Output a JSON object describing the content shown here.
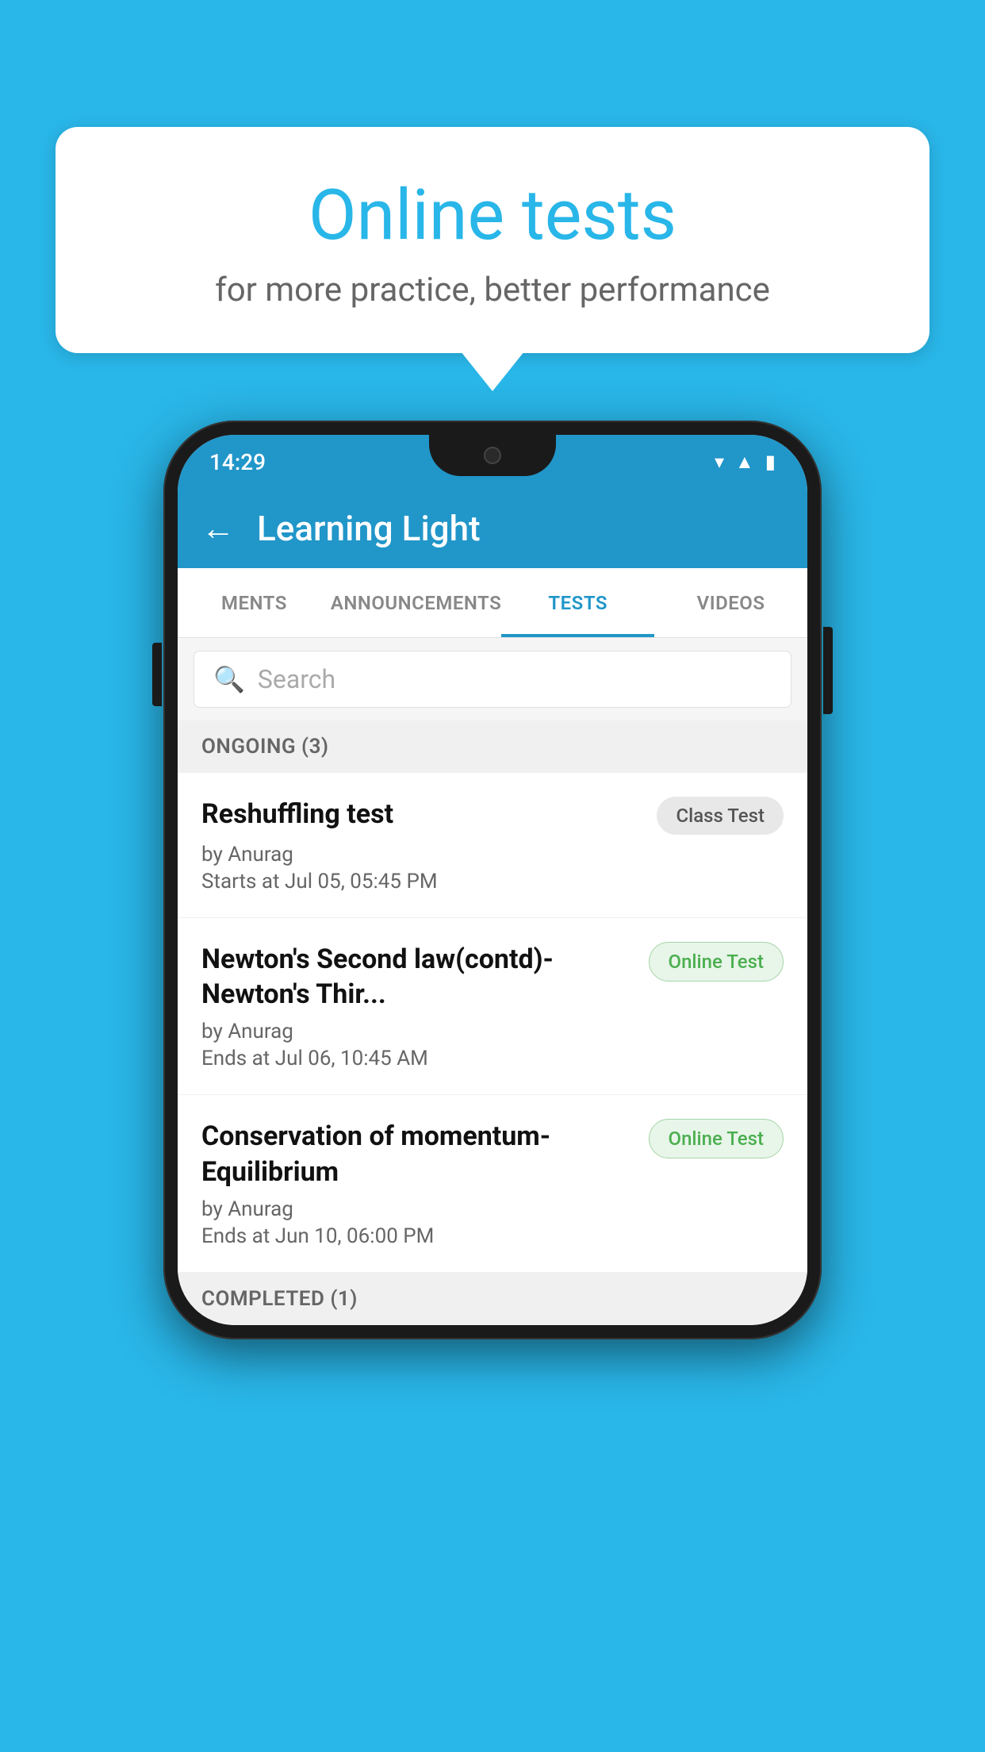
{
  "background": {
    "color": "#29b6e8"
  },
  "speech_bubble": {
    "title": "Online tests",
    "subtitle": "for more practice, better performance"
  },
  "phone": {
    "status_bar": {
      "time": "14:29",
      "icons": [
        "wifi",
        "signal",
        "battery"
      ]
    },
    "app_bar": {
      "title": "Learning Light",
      "back_label": "←"
    },
    "tabs": [
      {
        "label": "MENTS",
        "active": false
      },
      {
        "label": "ANNOUNCEMENTS",
        "active": false
      },
      {
        "label": "TESTS",
        "active": true
      },
      {
        "label": "VIDEOS",
        "active": false
      }
    ],
    "search": {
      "placeholder": "Search"
    },
    "ongoing_section": {
      "label": "ONGOING (3)"
    },
    "test_items": [
      {
        "name": "Reshuffling test",
        "badge": "Class Test",
        "badge_type": "class",
        "by": "by Anurag",
        "time_label": "Starts at",
        "time": "Jul 05, 05:45 PM"
      },
      {
        "name": "Newton's Second law(contd)-Newton's Thir...",
        "badge": "Online Test",
        "badge_type": "online",
        "by": "by Anurag",
        "time_label": "Ends at",
        "time": "Jul 06, 10:45 AM"
      },
      {
        "name": "Conservation of momentum-Equilibrium",
        "badge": "Online Test",
        "badge_type": "online",
        "by": "by Anurag",
        "time_label": "Ends at",
        "time": "Jun 10, 06:00 PM"
      }
    ],
    "completed_section": {
      "label": "COMPLETED (1)"
    }
  }
}
